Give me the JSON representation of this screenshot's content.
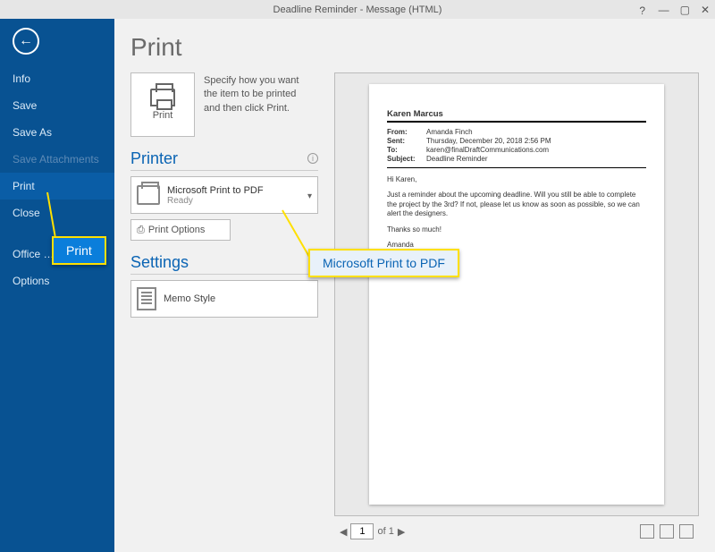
{
  "titlebar": {
    "title": "Deadline Reminder - Message (HTML)",
    "help": "?",
    "min": "—",
    "max": "▢",
    "close": "✕"
  },
  "sidebar": {
    "back": "←",
    "items": [
      {
        "label": "Info",
        "state": "normal"
      },
      {
        "label": "Save",
        "state": "normal"
      },
      {
        "label": "Save As",
        "state": "normal"
      },
      {
        "label": "Save Attachments",
        "state": "disabled"
      },
      {
        "label": "Print",
        "state": "active"
      },
      {
        "label": "Close",
        "state": "normal"
      },
      {
        "label": "Office …",
        "state": "normal"
      },
      {
        "label": "Options",
        "state": "normal"
      }
    ]
  },
  "page": {
    "title": "Print",
    "print_button_label": "Print",
    "instructions": "Specify how you want the item to be printed and then click Print."
  },
  "printer": {
    "heading": "Printer",
    "info_glyph": "i",
    "selected_name": "Microsoft Print to PDF",
    "selected_status": "Ready",
    "chevron": "▾",
    "options_label": "Print Options",
    "options_glyph": "⎙"
  },
  "settings": {
    "heading": "Settings",
    "style_name": "Memo Style"
  },
  "preview": {
    "recipient": "Karen Marcus",
    "fields": {
      "from_k": "From:",
      "from_v": "Amanda Finch",
      "sent_k": "Sent:",
      "sent_v": "Thursday, December 20, 2018 2:56 PM",
      "to_k": "To:",
      "to_v": "karen@finalDraftCommunications.com",
      "subj_k": "Subject:",
      "subj_v": "Deadline Reminder"
    },
    "body1": "Hi Karen,",
    "body2": "Just a reminder about the upcoming deadline. Will you still be able to complete the project by the 3rd? If not, please let us know as soon as possible, so we can alert the designers.",
    "body3": "Thanks so much!",
    "body4": "Amanda"
  },
  "pager": {
    "prev": "◀",
    "page_value": "1",
    "of_text": "of 1",
    "next": "▶"
  },
  "callouts": {
    "print": "Print",
    "printer": "Microsoft Print to PDF"
  }
}
